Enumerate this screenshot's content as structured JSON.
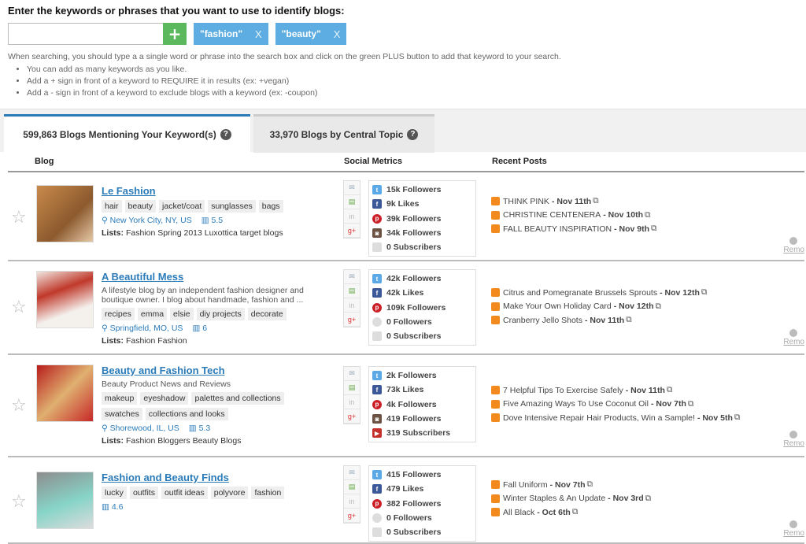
{
  "header": {
    "heading": "Enter the keywords or phrases that you want to use to identify blogs:",
    "search_value": "",
    "plus_label": "+",
    "keywords": [
      {
        "label": "\"fashion\"",
        "remove": "X"
      },
      {
        "label": "\"beauty\"",
        "remove": "X"
      }
    ],
    "help_text": "When searching, you should type a a single word or phrase into the search box and click on the green PLUS button to add that keyword to your search.",
    "tips": [
      "You can add as many keywords as you like.",
      "Add a + sign in front of a keyword to REQUIRE it in results (ex: +vegan)",
      "Add a - sign in front of a keyword to exclude blogs with a keyword (ex: -coupon)"
    ]
  },
  "tabs": [
    {
      "label": "599,863 Blogs Mentioning Your Keyword(s)",
      "help": "?"
    },
    {
      "label": "33,970 Blogs by Central Topic",
      "help": "?"
    }
  ],
  "columns": {
    "blog": "Blog",
    "social": "Social Metrics",
    "recent": "Recent Posts"
  },
  "colors": {
    "accent": "#2b7bb9",
    "plus": "#5cb85c",
    "chip": "#5dade2",
    "rss": "#f28a1e"
  },
  "rows": [
    {
      "title": "Le Fashion",
      "description": "",
      "tags": [
        "hair",
        "beauty",
        "jacket/coat",
        "sunglasses",
        "bags"
      ],
      "location": "New York City, NY, US",
      "rank": "5.5",
      "lists_label": "Lists:",
      "lists": "Fashion Spring 2013 Luxottica target blogs",
      "metrics": [
        {
          "icon": "twitter-icon",
          "text": "15k Followers"
        },
        {
          "icon": "facebook-icon",
          "text": "9k Likes"
        },
        {
          "icon": "pinterest-icon",
          "text": "39k Followers"
        },
        {
          "icon": "instagram-icon",
          "text": "34k Followers"
        },
        {
          "icon": "subscribers-icon",
          "text": "0 Subscribers"
        }
      ],
      "posts": [
        {
          "title": "THINK PINK",
          "date": "- Nov 11th"
        },
        {
          "title": "CHRISTINE CENTENERA",
          "date": "- Nov 10th"
        },
        {
          "title": "FALL BEAUTY INSPIRATION",
          "date": "- Nov 9th"
        }
      ],
      "remove": "Remo"
    },
    {
      "title": "A Beautiful Mess",
      "description": "A lifestyle blog by an independent fashion designer and boutique owner. I blog about handmade, fashion and ...",
      "tags": [
        "recipes",
        "emma",
        "elsie",
        "diy projects",
        "decorate"
      ],
      "location": "Springfield, MO, US",
      "rank": "6",
      "lists_label": "Lists:",
      "lists": "Fashion Fashion",
      "metrics": [
        {
          "icon": "twitter-icon",
          "text": "42k Followers"
        },
        {
          "icon": "facebook-icon",
          "text": "42k Likes"
        },
        {
          "icon": "pinterest-icon",
          "text": "109k Followers"
        },
        {
          "icon": "google-plus-icon",
          "text": "0 Followers"
        },
        {
          "icon": "subscribers-icon",
          "text": "0 Subscribers"
        }
      ],
      "posts": [
        {
          "title": "Citrus and Pomegranate Brussels Sprouts",
          "date": "- Nov 12th"
        },
        {
          "title": "Make Your Own Holiday Card",
          "date": "- Nov 12th"
        },
        {
          "title": "Cranberry Jello Shots",
          "date": "- Nov 11th"
        }
      ],
      "remove": "Remo"
    },
    {
      "title": "Beauty and Fashion Tech",
      "description": "Beauty Product News and Reviews",
      "tags": [
        "makeup",
        "eyeshadow",
        "palettes and collections",
        "swatches",
        "collections and looks"
      ],
      "location": "Shorewood, IL, US",
      "rank": "5.3",
      "lists_label": "Lists:",
      "lists": "Fashion Bloggers Beauty Blogs",
      "metrics": [
        {
          "icon": "twitter-icon",
          "text": "2k Followers"
        },
        {
          "icon": "facebook-icon",
          "text": "73k Likes"
        },
        {
          "icon": "pinterest-icon",
          "text": "4k Followers"
        },
        {
          "icon": "instagram-icon",
          "text": "419 Followers"
        },
        {
          "icon": "youtube-icon",
          "text": "319 Subscribers"
        }
      ],
      "posts": [
        {
          "title": "7 Helpful Tips To Exercise Safely",
          "date": "- Nov 11th"
        },
        {
          "title": "Five Amazing Ways To Use Coconut Oil",
          "date": "- Nov 7th"
        },
        {
          "title": "Dove Intensive Repair Hair Products, Win a Sample!",
          "date": "- Nov 5th"
        }
      ],
      "remove": "Remo"
    },
    {
      "title": "Fashion and Beauty Finds",
      "description": "",
      "tags": [
        "lucky",
        "outfits",
        "outfit ideas",
        "polyvore",
        "fashion"
      ],
      "location": "",
      "rank": "4.6",
      "lists_label": "",
      "lists": "",
      "metrics": [
        {
          "icon": "twitter-icon",
          "text": "415 Followers"
        },
        {
          "icon": "facebook-icon",
          "text": "479 Likes"
        },
        {
          "icon": "pinterest-icon",
          "text": "382 Followers"
        },
        {
          "icon": "google-plus-icon",
          "text": "0 Followers"
        },
        {
          "icon": "subscribers-icon",
          "text": "0 Subscribers"
        }
      ],
      "posts": [
        {
          "title": "Fall Uniform",
          "date": "- Nov 7th"
        },
        {
          "title": "Winter Staples & An Update",
          "date": "- Nov 3rd"
        },
        {
          "title": "All Black",
          "date": "- Oct 6th"
        }
      ],
      "remove": "Remo"
    }
  ]
}
